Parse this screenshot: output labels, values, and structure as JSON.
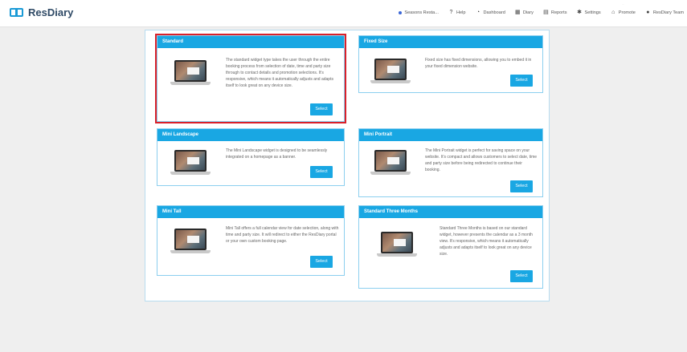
{
  "app": {
    "name": "ResDiary"
  },
  "nav": {
    "corner_text": "...",
    "items": [
      {
        "label": "Seasons Resta...",
        "icon": "dot"
      },
      {
        "label": "Help",
        "icon": "help-icon"
      },
      {
        "label": "Dashboard",
        "icon": "dashboard-icon"
      },
      {
        "label": "Diary",
        "icon": "diary-icon"
      },
      {
        "label": "Reports",
        "icon": "reports-icon"
      },
      {
        "label": "Settings",
        "icon": "settings-icon"
      },
      {
        "label": "Promote",
        "icon": "promote-icon"
      },
      {
        "label": "ResDiary Team",
        "icon": "user-icon"
      }
    ]
  },
  "cards": [
    {
      "title": "Standard",
      "description": "The standard widget type takes the user through the entire booking process from selection of date, time and party size through to contact details and promotion selections. It's responsive, which means it automatically adjusts and adapts itself to look great on any device size.",
      "button": "Select"
    },
    {
      "title": "Fixed Size",
      "description": "Fixed size has fixed dimensions, allowing you to embed it in your fixed dimension website.",
      "button": "Select"
    },
    {
      "title": "Mini Landscape",
      "description": "The Mini Landscape widget is designed to be seamlessly integrated on a homepage as a banner.",
      "button": "Select"
    },
    {
      "title": "Mini Portrait",
      "description": "The Mini Portrait widget is perfect for saving space on your website. It's compact and allows customers to select date, time and party size before being redirected to continue their booking.",
      "button": "Select"
    },
    {
      "title": "Mini Tall",
      "description": "Mini Tall offers a full calendar view for date selection, along with time and party size. It will redirect to either the ResDiary portal or your own custom booking page.",
      "button": "Select"
    },
    {
      "title": "Standard Three Months",
      "description": "Standard Three Months is based on our standard widget, however presents the calendar as a 3 month view. It's responsive, which means it automatically adjusts and adapts itself to look great on any device size.",
      "button": "Select"
    }
  ],
  "colors": {
    "accent": "#19a7e3",
    "highlight": "#d9202a"
  }
}
